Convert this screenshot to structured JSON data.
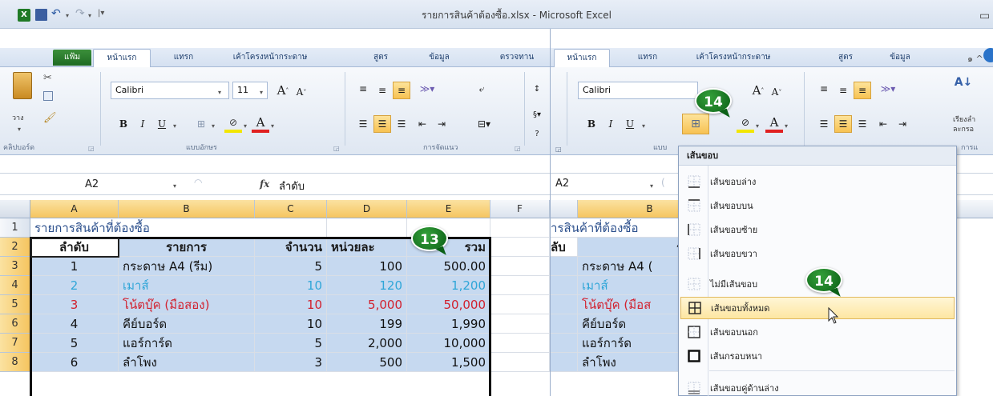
{
  "window": {
    "title": "รายการสินค้าต้องซื้อ.xlsx - Microsoft Excel",
    "app_icon": "excel-icon"
  },
  "ribbon_tabs": [
    "แฟ้ม",
    "หน้าแรก",
    "แทรก",
    "เค้าโครงหน้ากระดาษ",
    "สูตร",
    "ข้อมูล",
    "ตรวจทาน"
  ],
  "ribbon_tabs_right": [
    "หน้าแรก",
    "แทรก",
    "เค้าโครงหน้ากระดาษ",
    "สูตร",
    "ข้อมูล"
  ],
  "ribbon": {
    "paste_label": "วาง",
    "clipboard_group": "คลิปบอร์ด",
    "font_group": "แบบอักษร",
    "font_group_right": "แบบ",
    "alignment_group": "การจัดแนว",
    "right_partial_group": "การแ",
    "right_partial_text1": "เรียงลำ",
    "right_partial_text2": "ละกรอ",
    "font_name": "Calibri",
    "font_size": "11",
    "bold": "B",
    "italic": "I",
    "underline": "U"
  },
  "formula_bar": {
    "name_box": "A2",
    "name_box_right": "A2",
    "fx": "fx",
    "content": "ลำดับ"
  },
  "columns": [
    "A",
    "B",
    "C",
    "D",
    "E",
    "F"
  ],
  "columns_right": [
    "B"
  ],
  "rows": [
    "1",
    "2",
    "3",
    "4",
    "5",
    "6",
    "7",
    "8"
  ],
  "sheet": {
    "title": "รายการสินค้าที่ต้องซื้อ",
    "title_right": "ารสินค้าที่ต้องซื้อ",
    "headers": [
      "ลำดับ",
      "รายการ",
      "จำนวน",
      "หน่วยละ",
      "รวม"
    ],
    "header_right_a": "ลับ",
    "header_right_b": "รายการ",
    "data": [
      {
        "no": "1",
        "item": "กระดาษ  A4 (รีม)",
        "qty": "5",
        "unit": "100",
        "total": "500.00",
        "item_right": "กระดาษ  A4 ("
      },
      {
        "no": "2",
        "item": "เมาส์",
        "qty": "10",
        "unit": "120",
        "total": "1,200",
        "item_right": "เมาส์"
      },
      {
        "no": "3",
        "item": "โน้ตบุ๊ค  (มือสอง)",
        "qty": "10",
        "unit": "5,000",
        "total": "50,000",
        "item_right": "โน้ตบุ๊ค  (มือส"
      },
      {
        "no": "4",
        "item": "คีย์บอร์ด",
        "qty": "10",
        "unit": "199",
        "total": "1,990",
        "item_right": "คีย์บอร์ด"
      },
      {
        "no": "5",
        "item": "แอร์การ์ด",
        "qty": "5",
        "unit": "2,000",
        "total": "10,000",
        "item_right": "แอร์การ์ด"
      },
      {
        "no": "6",
        "item": "ลำโพง",
        "qty": "3",
        "unit": "500",
        "total": "1,500",
        "item_right": "ลำโพง"
      }
    ]
  },
  "badges": {
    "b13": "13",
    "b14a": "14",
    "b14b": "14"
  },
  "border_menu": {
    "header": "เส้นขอบ",
    "items": [
      {
        "label": "เส้นขอบล่าง",
        "icon": "bottom-border-icon"
      },
      {
        "label": "เส้นขอบบน",
        "icon": "top-border-icon"
      },
      {
        "label": "เส้นขอบซ้าย",
        "icon": "left-border-icon"
      },
      {
        "label": "เส้นขอบขวา",
        "icon": "right-border-icon"
      },
      {
        "label": "ไม่มีเส้นขอบ",
        "icon": "no-border-icon"
      },
      {
        "label": "เส้นขอบทั้งหมด",
        "icon": "all-borders-icon"
      },
      {
        "label": "เส้นขอบนอก",
        "icon": "outside-borders-icon"
      },
      {
        "label": "เส้นกรอบหนา",
        "icon": "thick-box-border-icon"
      },
      {
        "label": "เส้นขอบคู่ด้านล่าง",
        "icon": "bottom-double-border-icon"
      }
    ]
  },
  "colors": {
    "selection_blue": "#c6d9f0",
    "header_orange": "#f5c560",
    "text_cyan": "#2fa6d8",
    "text_red": "#d2212e",
    "badge_green": "#1f7a25"
  }
}
